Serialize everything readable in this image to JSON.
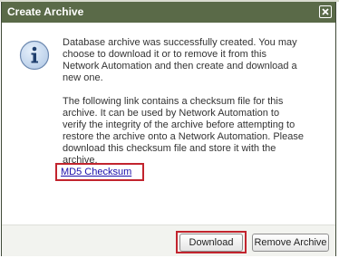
{
  "dialog": {
    "title": "Create Archive",
    "close_icon": "close-icon",
    "info_icon": "info-icon",
    "message_paragraph_1": "Database archive was successfully created. You may\nchoose to download it or to remove it from this\nNetwork Automation and then create and download a\nnew one.",
    "message_paragraph_2": "The following link contains a checksum file for this\narchive. It can be used by Network Automation to\nverify the integrity of the archive before attempting to\nrestore the archive onto a Network Automation. Please\ndownload this checksum file and store it with the\narchive.",
    "checksum_link": "MD5 Checksum",
    "buttons": {
      "download": "Download",
      "remove": "Remove Archive"
    },
    "colors": {
      "titlebar": "#5a6a48",
      "highlight": "#c2242e",
      "link": "#1a0dab"
    }
  }
}
